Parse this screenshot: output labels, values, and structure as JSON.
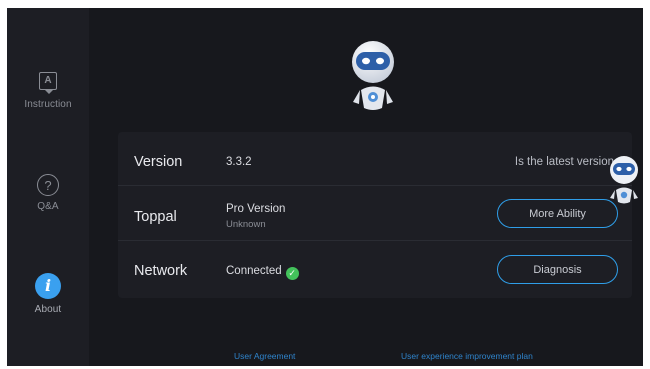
{
  "sidebar": {
    "items": [
      {
        "icon": "instruction-icon",
        "glyph": "A",
        "label": "Instruction",
        "active": false
      },
      {
        "icon": "question-icon",
        "glyph": "?",
        "label": "Q&A",
        "active": false
      },
      {
        "icon": "info-icon",
        "glyph": "i",
        "label": "About",
        "active": true
      }
    ]
  },
  "about": {
    "version": {
      "label": "Version",
      "value": "3.3.2",
      "status": "Is the latest version"
    },
    "toppal": {
      "label": "Toppal",
      "value": "Pro Version",
      "sub": "Unknown",
      "button": "More Ability"
    },
    "network": {
      "label": "Network",
      "value": "Connected",
      "button": "Diagnosis"
    }
  },
  "footer": {
    "user_agreement": "User Agreement",
    "improvement_plan": "User experience improvement plan"
  },
  "colors": {
    "background": "#17181d",
    "panel": "#1d1e24",
    "accent": "#2f9ee8",
    "success": "#43c25b"
  }
}
